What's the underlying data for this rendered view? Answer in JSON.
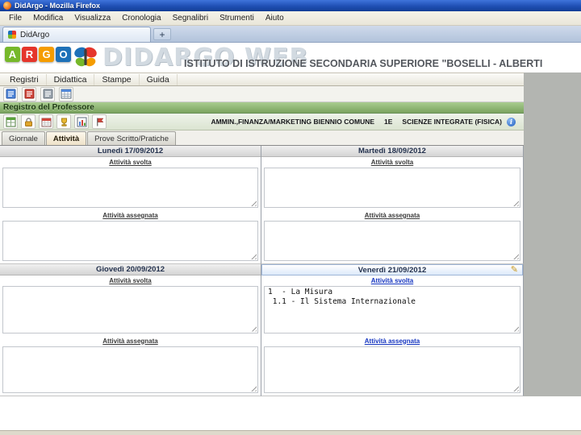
{
  "window": {
    "title": "DidArgo - Mozilla Firefox",
    "menu": [
      "File",
      "Modifica",
      "Visualizza",
      "Cronologia",
      "Segnalibri",
      "Strumenti",
      "Aiuto"
    ]
  },
  "browser_tab": {
    "label": "DidArgo",
    "new_tab": "+"
  },
  "banner": {
    "logo": [
      {
        "char": "A",
        "color": "#76b82a"
      },
      {
        "char": "R",
        "color": "#e5352b"
      },
      {
        "char": "G",
        "color": "#f59c00"
      },
      {
        "char": "O",
        "color": "#1e71b8"
      }
    ],
    "watermark": "DIDARGO WEB",
    "school_name": "ISTITUTO DI ISTRUZIONE SECONDARIA SUPERIORE \"BOSELLI - ALBERTI"
  },
  "app_menu": {
    "items": [
      "Registri",
      "Didattica",
      "Stampe",
      "Guida"
    ]
  },
  "registro": {
    "title": "Registro del Professore"
  },
  "class_bar": {
    "course": "AMMIN.,FINANZA/MARKETING BIENNIO COMUNE",
    "class": "1E",
    "subject": "SCIENZE INTEGRATE (FISICA)"
  },
  "view_tabs": [
    {
      "label": "Giornale",
      "active": false
    },
    {
      "label": "Attività",
      "active": true
    },
    {
      "label": "Prove Scritto/Pratiche",
      "active": false
    }
  ],
  "week": {
    "svolta_label": "Attività svolta",
    "assegnata_label": "Attività assegnata",
    "days": [
      {
        "name": "Lunedì 17/09/2012",
        "selected": false,
        "svolta": "",
        "assegnata": ""
      },
      {
        "name": "Martedì 18/09/2012",
        "selected": false,
        "svolta": "",
        "assegnata": ""
      },
      {
        "name": "Giovedì 20/09/2012",
        "selected": false,
        "svolta": "",
        "assegnata": ""
      },
      {
        "name": "Venerdì 21/09/2012",
        "selected": true,
        "svolta": "1  - La Misura\n 1.1 - Il Sistema Internazionale",
        "assegnata": ""
      }
    ]
  },
  "icons": {
    "info": "i",
    "pencil": "✎"
  },
  "colors": {
    "titlebar_blue": "#1f4fb4",
    "registro_bar_green": "#7aa35f",
    "selected_day_link": "#1535c0",
    "argo_green": "#76b82a",
    "argo_red": "#e5352b",
    "argo_orange": "#f59c00",
    "argo_blue": "#1e71b8"
  }
}
